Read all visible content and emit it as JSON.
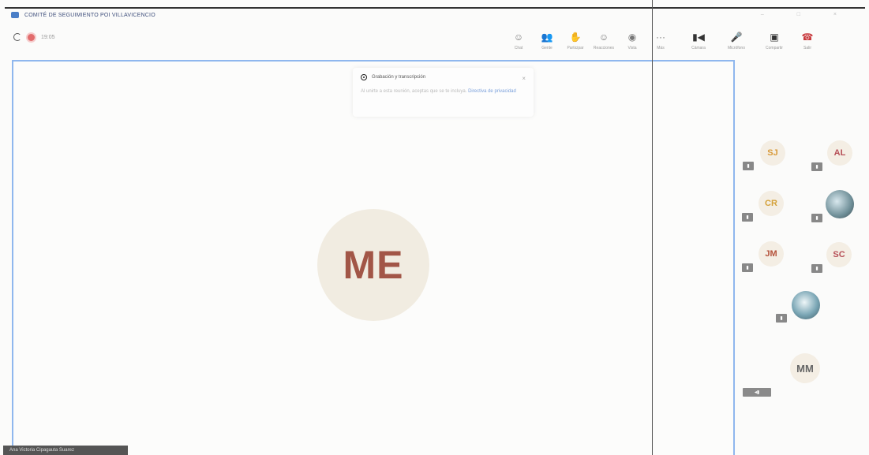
{
  "window": {
    "title": "COMITÉ DE SEGUIMIENTO POI VILLAVICENCIO",
    "controls": "– □ ×"
  },
  "meeting": {
    "timer": "19:05"
  },
  "toolbar": {
    "items": [
      {
        "label": "Chat",
        "icon": "chat-icon",
        "glyph": "☺"
      },
      {
        "label": "Gente",
        "icon": "people-icon",
        "glyph": "👥"
      },
      {
        "label": "Participar",
        "icon": "raise-hand-icon",
        "glyph": "✋"
      },
      {
        "label": "Reacciones",
        "icon": "reactions-icon",
        "glyph": "☺"
      },
      {
        "label": "Vista",
        "icon": "view-icon",
        "glyph": "◉"
      },
      {
        "label": "Más",
        "icon": "more-icon",
        "glyph": "···"
      },
      {
        "label": "Cámara",
        "icon": "camera-icon",
        "glyph": "▮◀"
      },
      {
        "label": "Micrófono",
        "icon": "microphone-icon",
        "glyph": "🎤"
      },
      {
        "label": "Compartir",
        "icon": "share-icon",
        "glyph": "▣"
      },
      {
        "label": "Salir",
        "icon": "leave-icon",
        "glyph": "☎"
      }
    ]
  },
  "notice": {
    "title": "Grabación y transcripción",
    "body": "Al unirte a esta reunión, aceptas que se te incluya.",
    "link": "Directiva de privacidad"
  },
  "main": {
    "avatar_initials": "ME",
    "speaker_name": "Ana Victoria Cipagauta Suarez"
  },
  "participants": [
    {
      "initials": "SJ",
      "color": "#d89a3a"
    },
    {
      "initials": "AL",
      "color": "#b64f57"
    },
    {
      "initials": "CR",
      "color": "#d4a13a"
    },
    {
      "initials": "",
      "color": "#6f8f98",
      "photo": true
    },
    {
      "initials": "JM",
      "color": "#b4513a"
    },
    {
      "initials": "SC",
      "color": "#b64f57"
    },
    {
      "initials": "",
      "color": "#5d8a9e",
      "photo": true
    },
    {
      "initials": "MM",
      "color": "#666666"
    }
  ]
}
